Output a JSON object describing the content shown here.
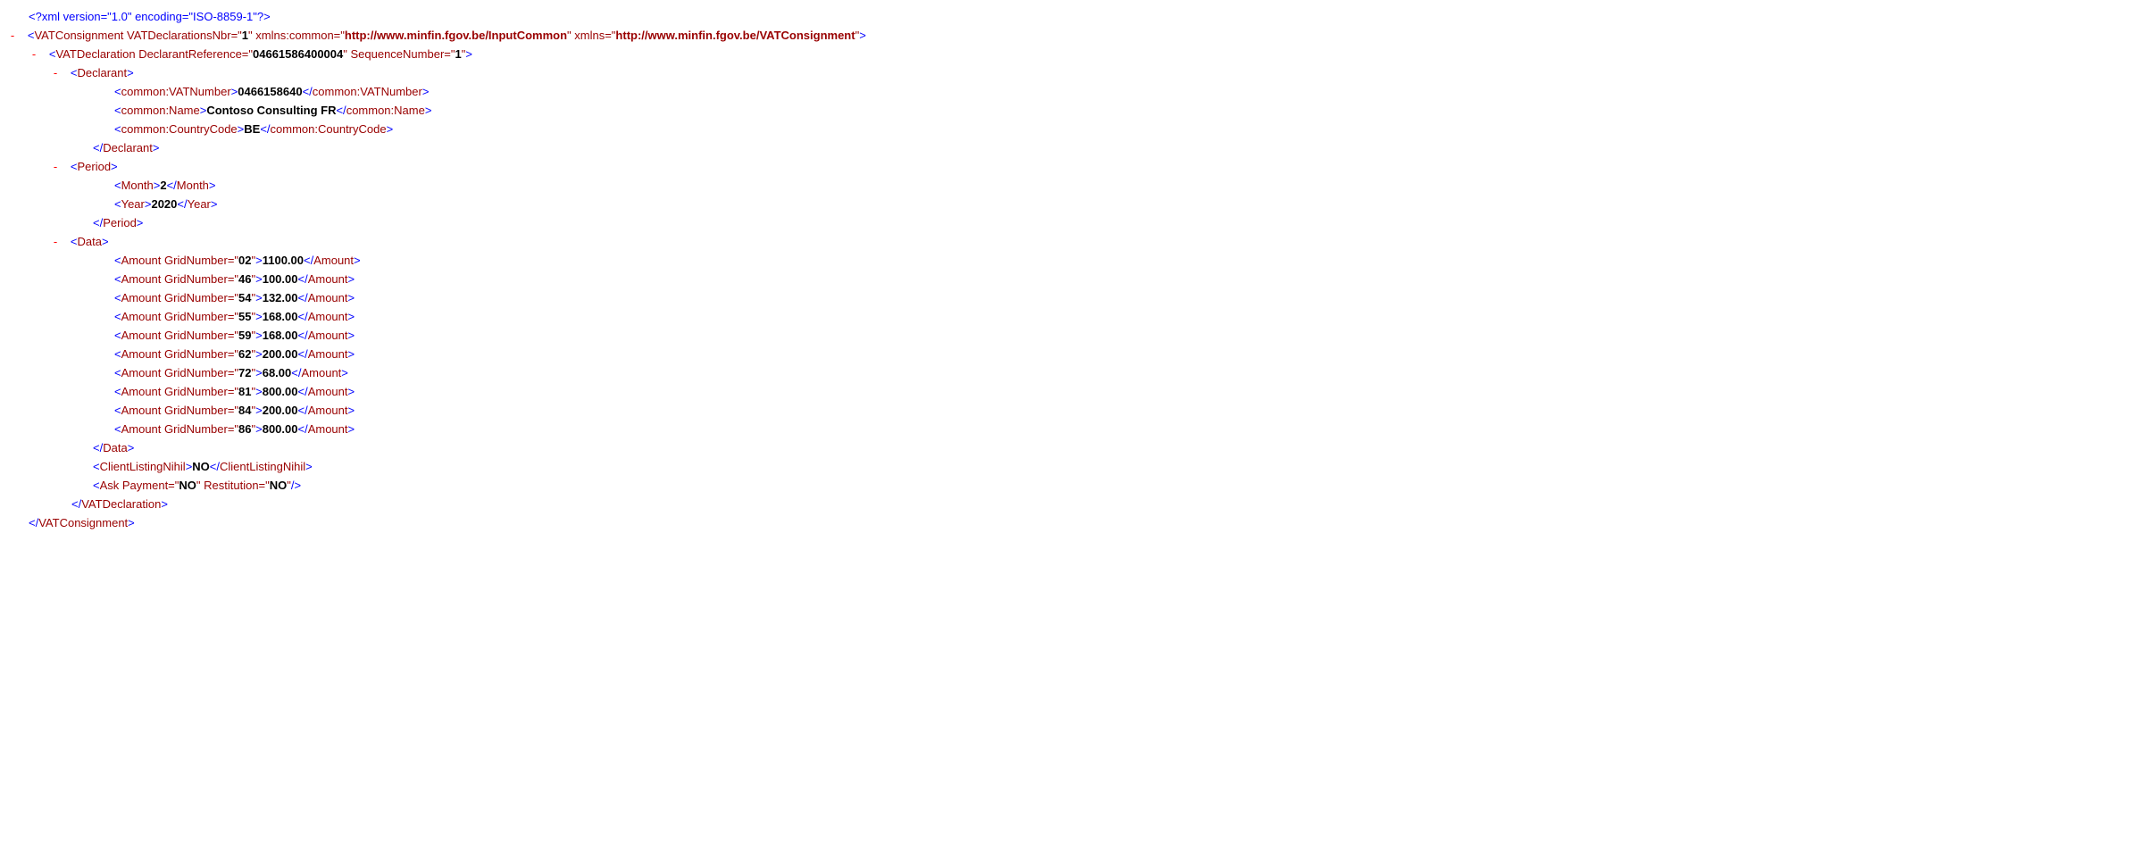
{
  "xmlDecl": {
    "open": "<?",
    "name": "xml",
    "attrs": " version=\"1.0\" encoding=\"ISO-8859-1\"",
    "close": "?>"
  },
  "root": {
    "toggle": "-",
    "name": "VATConsignment",
    "a1name": " VATDeclarationsNbr=\"",
    "a1val": "1",
    "a2name": "xmlns:common=\"",
    "a2val": "http://www.minfin.fgov.be/InputCommon",
    "a3name": "xmlns=\"",
    "a3val": "http://www.minfin.fgov.be/VATConsignment",
    "close": "VATConsignment"
  },
  "decl": {
    "toggle": "-",
    "name": "VATDeclaration",
    "a1name": " DeclarantReference=\"",
    "a1val": "04661586400004",
    "a2name": " SequenceNumber=\"",
    "a2val": "1",
    "close": "VATDeclaration"
  },
  "declarant": {
    "toggle": "-",
    "name": "Declarant",
    "vatOpen": "common:VATNumber",
    "vatVal": "0466158640",
    "nameOpen": "common:Name",
    "nameVal": "Contoso Consulting FR",
    "ccOpen": "common:CountryCode",
    "ccVal": "BE"
  },
  "period": {
    "toggle": "-",
    "name": "Period",
    "monthOpen": "Month",
    "monthVal": "2",
    "yearOpen": "Year",
    "yearVal": "2020"
  },
  "data": {
    "toggle": "-",
    "name": "Data",
    "amountName": "Amount",
    "gridPrefix": " GridNumber=\"",
    "rows": {
      "r0g": "02",
      "r0v": "1100.00",
      "r1g": "46",
      "r1v": "100.00",
      "r2g": "54",
      "r2v": "132.00",
      "r3g": "55",
      "r3v": "168.00",
      "r4g": "59",
      "r4v": "168.00",
      "r5g": "62",
      "r5v": "200.00",
      "r6g": "72",
      "r6v": "68.00",
      "r7g": "81",
      "r7v": "800.00",
      "r8g": "84",
      "r8v": "200.00",
      "r9g": "86",
      "r9v": "800.00"
    }
  },
  "clientListing": {
    "name": "ClientListingNihil",
    "val": "NO"
  },
  "ask": {
    "name": "Ask",
    "a1name": " Payment=\"",
    "a1val": "NO",
    "a2name": " Restitution=\"",
    "a2val": "NO"
  }
}
